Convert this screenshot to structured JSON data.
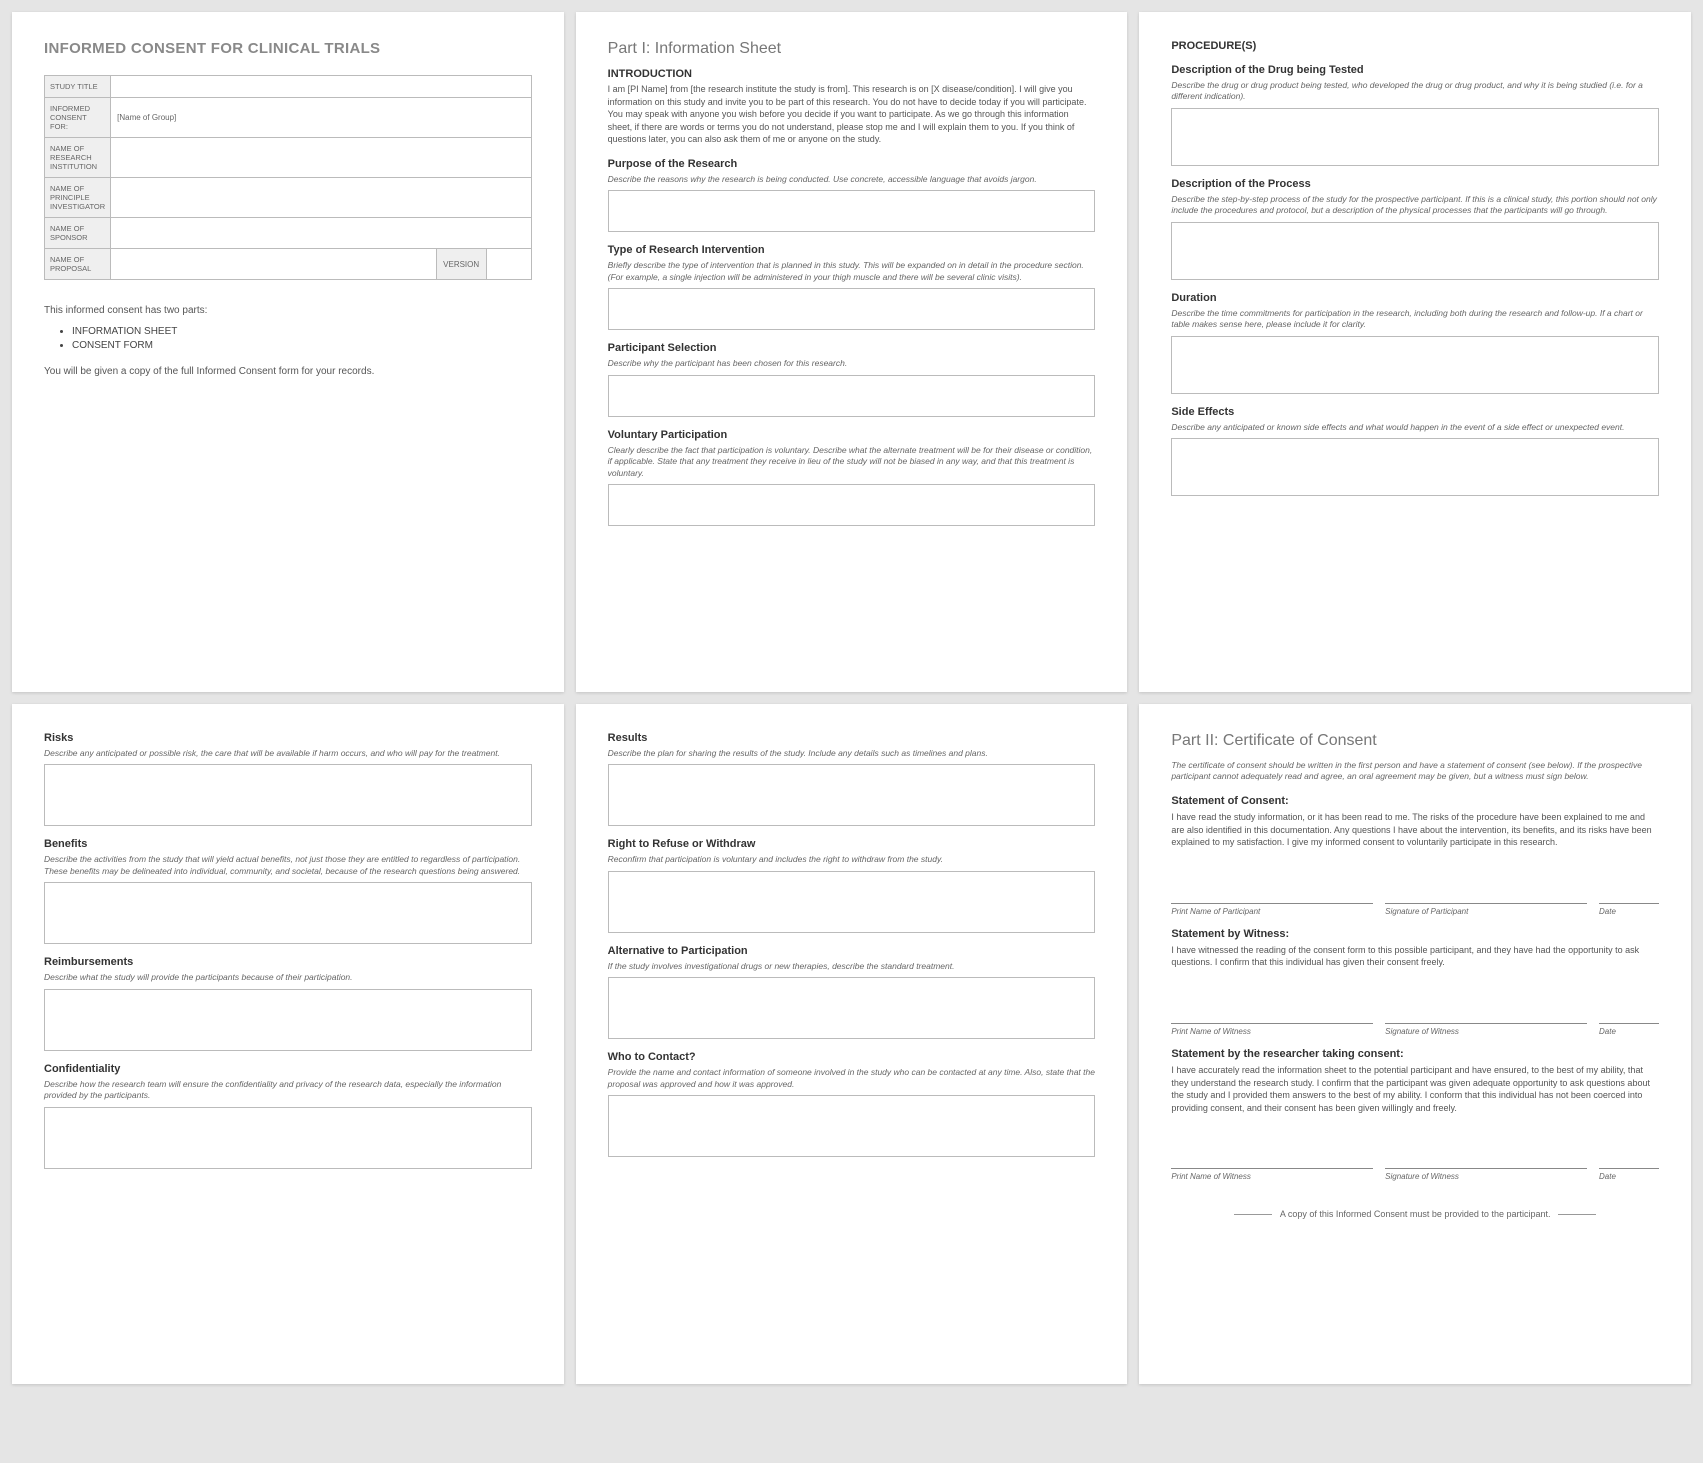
{
  "page1": {
    "title": "INFORMED CONSENT FOR CLINICAL TRIALS",
    "table": {
      "studyTitle": "STUDY TITLE",
      "consentFor": "INFORMED CONSENT FOR:",
      "consentForVal": "[Name of Group]",
      "researchInst": "NAME OF RESEARCH INSTITUTION",
      "principle": "NAME OF PRINCIPLE INVESTIGATOR",
      "sponsor": "NAME OF SPONSOR",
      "proposal": "NAME OF PROPOSAL",
      "version": "VERSION"
    },
    "intro": "This informed consent has two parts:",
    "bullets": [
      "INFORMATION SHEET",
      "CONSENT FORM"
    ],
    "note": "You will be given a copy of the full Informed Consent form for your records."
  },
  "page2": {
    "part": "Part I: Information Sheet",
    "s1": {
      "h": "INTRODUCTION",
      "p": "I am [PI Name] from [the research institute the study is from]. This research is on [X disease/condition]. I will give you information on this study and invite you to be part of this research. You do not have to decide today if you will participate. You may speak with anyone you wish before you decide if you want to participate. As we go through this information sheet, if there are words or terms you do not understand, please stop me and I will explain them to you. If you think of questions later, you can also ask them of me or anyone on the study."
    },
    "s2": {
      "h": "Purpose of the Research",
      "p": "Describe the reasons why the research is being conducted. Use concrete, accessible language that avoids jargon."
    },
    "s3": {
      "h": "Type of Research Intervention",
      "p": "Briefly describe the type of intervention that is planned in this study. This will be expanded on in detail in the procedure section. (For example, a single injection will be administered in your thigh muscle and there will be several clinic visits)."
    },
    "s4": {
      "h": "Participant Selection",
      "p": "Describe why the participant has been chosen for this research."
    },
    "s5": {
      "h": "Voluntary Participation",
      "p": "Clearly describe the fact that participation is voluntary. Describe what the alternate treatment will be for their disease or condition, if applicable. State that any treatment they receive in lieu of the study will not be biased in any way, and that this treatment is voluntary."
    }
  },
  "page3": {
    "h": "PROCEDURE(S)",
    "s1": {
      "h": "Description of the Drug being Tested",
      "p": "Describe the drug or drug product being tested, who developed the drug or drug product, and why it is being studied (i.e. for a different indication)."
    },
    "s2": {
      "h": "Description of the Process",
      "p": "Describe the step-by-step process of the study for the prospective participant. If this is a clinical study, this portion should not only include the procedures and protocol, but a description of the physical processes that the participants will go through."
    },
    "s3": {
      "h": "Duration",
      "p": "Describe the time commitments for participation in the research, including both during the research and follow-up. If a chart or table makes sense here, please include it for clarity."
    },
    "s4": {
      "h": "Side Effects",
      "p": "Describe any anticipated or known side effects and what would happen in the event of a side effect or unexpected event."
    }
  },
  "page4": {
    "s1": {
      "h": "Risks",
      "p": "Describe any anticipated or possible risk, the care that will be available if harm occurs, and who will pay for the treatment."
    },
    "s2": {
      "h": "Benefits",
      "p": "Describe the activities from the study that will yield actual benefits, not just those they are entitled to regardless of participation. These benefits may be delineated into individual, community, and societal, because of the research questions being answered."
    },
    "s3": {
      "h": "Reimbursements",
      "p": "Describe what the study will provide the participants because of their participation."
    },
    "s4": {
      "h": "Confidentiality",
      "p": "Describe how the research team will ensure the confidentiality and privacy of the research data, especially the information provided by the participants."
    }
  },
  "page5": {
    "s1": {
      "h": "Results",
      "p": "Describe the plan for sharing the results of the study. Include any details such as timelines and plans."
    },
    "s2": {
      "h": "Right to Refuse or Withdraw",
      "p": "Reconfirm that participation is voluntary and includes the right to withdraw from the study."
    },
    "s3": {
      "h": "Alternative to Participation",
      "p": "If the study involves investigational drugs or new therapies, describe the standard treatment."
    },
    "s4": {
      "h": "Who to Contact?",
      "p": "Provide the name and contact information of someone involved in the study who can be contacted at any time. Also, state that the proposal was approved and how it was approved."
    }
  },
  "page6": {
    "part": "Part II: Certificate of Consent",
    "intro": "The certificate of consent should be written in the first person and have a statement of consent (see below). If the prospective participant cannot adequately read and agree, an oral agreement may be given, but a witness must sign below.",
    "s1": {
      "h": "Statement of Consent:",
      "p": "I have read the study information, or it has been read to me. The risks of the procedure have been explained to me and are also identified in this documentation. Any questions I have about the intervention, its benefits, and its risks have been explained to my satisfaction. I give my informed consent to voluntarily participate in this research."
    },
    "sig1": {
      "a": "Print Name of Participant",
      "b": "Signature of Participant",
      "c": "Date"
    },
    "s2": {
      "h": "Statement by Witness:",
      "p": "I have witnessed the reading of the consent form to this possible participant, and they have had the opportunity to ask questions. I confirm that this individual has given their consent freely."
    },
    "sig2": {
      "a": "Print Name of Witness",
      "b": "Signature of Witness",
      "c": "Date"
    },
    "s3": {
      "h": "Statement by the researcher taking consent:",
      "p": "I have accurately read the information sheet to the potential participant and have ensured, to the best of my ability, that they understand the research study. I confirm that the participant was given adequate opportunity to ask questions about the study and I provided them answers to the best of my ability. I conform that this individual has not been coerced into providing consent, and their consent has been given willingly and freely."
    },
    "sig3": {
      "a": "Print Name of Witness",
      "b": "Signature of Witness",
      "c": "Date"
    },
    "footer": "A copy of this Informed Consent must be provided to the participant."
  }
}
